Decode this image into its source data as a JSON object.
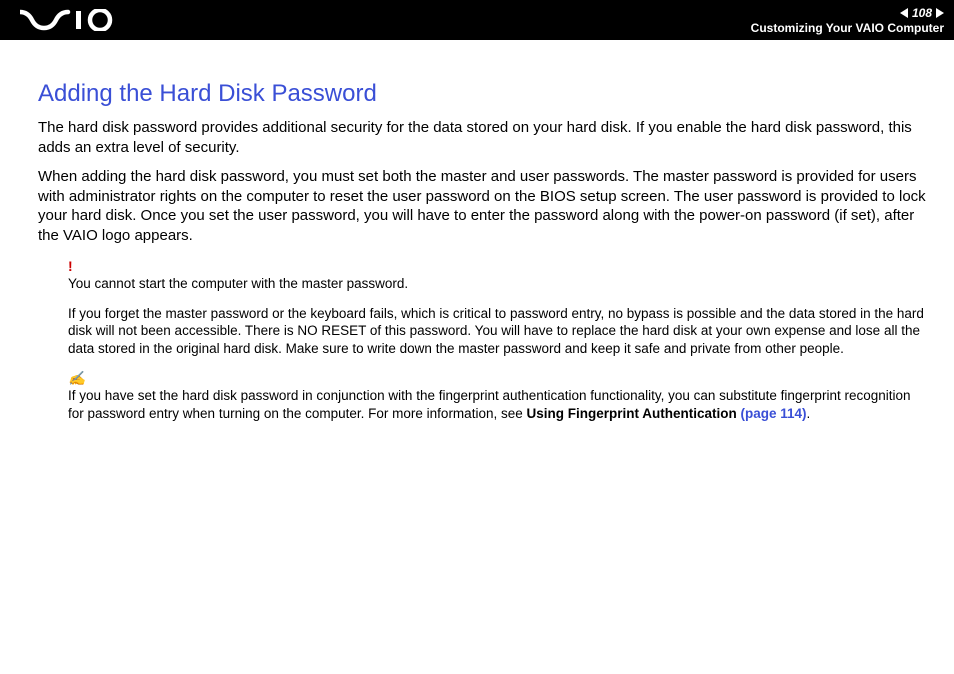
{
  "header": {
    "page_number": "108",
    "section": "Customizing Your VAIO Computer"
  },
  "content": {
    "title": "Adding the Hard Disk Password",
    "p1": "The hard disk password provides additional security for the data stored on your hard disk. If you enable the hard disk password, this adds an extra level of security.",
    "p2": "When adding the hard disk password, you must set both the master and user passwords. The master password is provided for users with administrator rights on the computer to reset the user password on the BIOS setup screen. The user password is provided to lock your hard disk. Once you set the user password, you will have to enter the password along with the power-on password (if set), after the VAIO logo appears."
  },
  "warning": {
    "icon": "!",
    "line1": "You cannot start the computer with the master password.",
    "line2": "If you forget the master password or the keyboard fails, which is critical to password entry, no bypass is possible and the data stored in the hard disk will not been accessible. There is NO RESET of this password. You will have to replace the hard disk at your own expense and lose all the data stored in the original hard disk. Make sure to write down the master password and keep it safe and private from other people."
  },
  "tip": {
    "icon": "✍",
    "text_prefix": "If you have set the hard disk password in conjunction with the fingerprint authentication functionality, you can substitute fingerprint recognition for password entry when turning on the computer. For more information, see ",
    "link_bold": "Using Fingerprint Authentication ",
    "link_page": "(page 114)",
    "text_suffix": "."
  }
}
